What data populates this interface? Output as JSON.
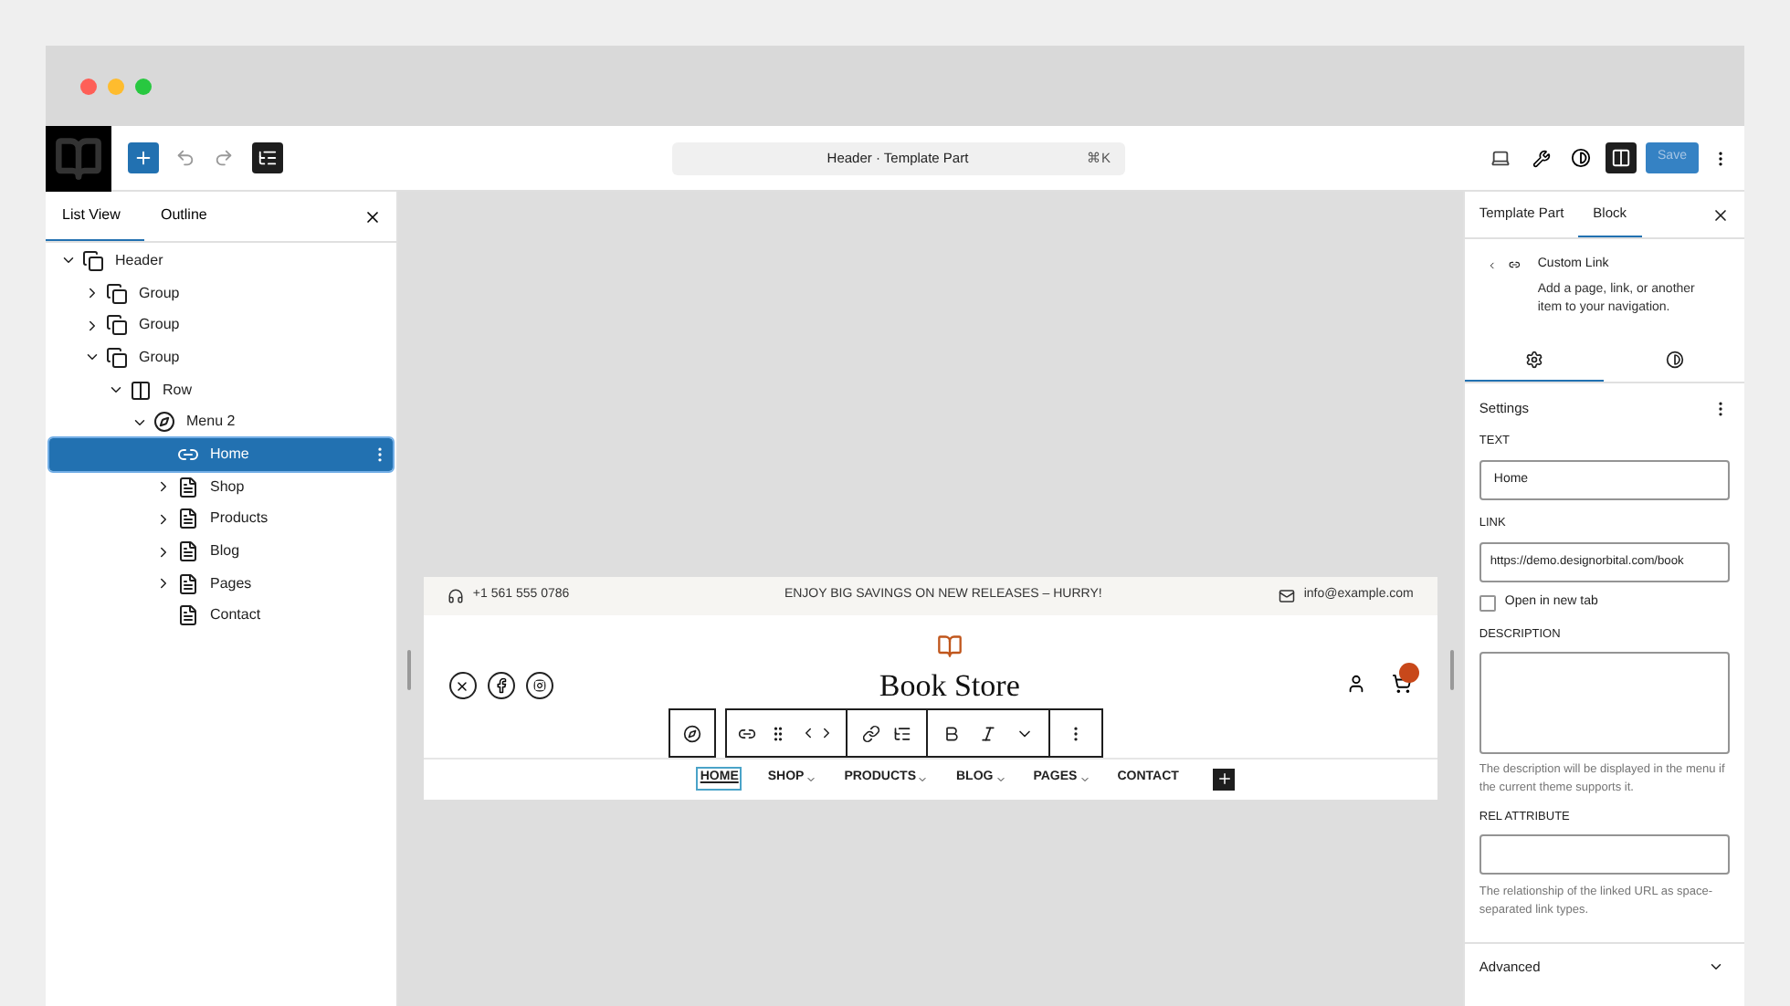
{
  "toolbar": {
    "command_title": "Header · Template Part",
    "shortcut": "⌘K",
    "save_label": "Save"
  },
  "left_panel": {
    "tabs": [
      {
        "label": "List View",
        "selected": true
      },
      {
        "label": "Outline",
        "selected": false
      }
    ],
    "tree": [
      {
        "label": "Header",
        "kind": "group",
        "expanded": true,
        "selected": false,
        "children": [
          {
            "label": "Group",
            "kind": "group",
            "expanded": false,
            "selected": false
          },
          {
            "label": "Group",
            "kind": "group",
            "expanded": false,
            "selected": false
          },
          {
            "label": "Group",
            "kind": "group",
            "expanded": true,
            "selected": false,
            "children": [
              {
                "label": "Row",
                "kind": "row",
                "expanded": true,
                "selected": false,
                "children": [
                  {
                    "label": "Menu 2",
                    "kind": "navigation",
                    "expanded": true,
                    "selected": false,
                    "children": [
                      {
                        "label": "Home",
                        "kind": "link",
                        "selected": true
                      },
                      {
                        "label": "Shop",
                        "kind": "page",
                        "expanded": false,
                        "selected": false
                      },
                      {
                        "label": "Products",
                        "kind": "page",
                        "expanded": false,
                        "selected": false
                      },
                      {
                        "label": "Blog",
                        "kind": "page",
                        "expanded": false,
                        "selected": false
                      },
                      {
                        "label": "Pages",
                        "kind": "page",
                        "expanded": false,
                        "selected": false
                      },
                      {
                        "label": "Contact",
                        "kind": "page",
                        "selected": false
                      }
                    ]
                  }
                ]
              }
            ]
          }
        ]
      }
    ]
  },
  "canvas": {
    "phone": "+1 561 555 0786",
    "promo": "ENJOY BIG SAVINGS ON NEW RELEASES – HURRY!",
    "email": "info@example.com",
    "site_title": "Book Store",
    "nav": [
      {
        "label": "HOME",
        "submenu": false,
        "selected": true
      },
      {
        "label": "SHOP",
        "submenu": true,
        "selected": false
      },
      {
        "label": "PRODUCTS",
        "submenu": true,
        "selected": false
      },
      {
        "label": "BLOG",
        "submenu": true,
        "selected": false
      },
      {
        "label": "PAGES",
        "submenu": true,
        "selected": false
      },
      {
        "label": "CONTACT",
        "submenu": false,
        "selected": false
      }
    ]
  },
  "right_panel": {
    "tabs": [
      {
        "label": "Template Part",
        "selected": false
      },
      {
        "label": "Block",
        "selected": true
      }
    ],
    "block": {
      "title": "Custom Link",
      "description": "Add a page, link, or another item to your navigation."
    },
    "subtabs": [
      {
        "kind": "settings",
        "selected": true
      },
      {
        "kind": "styles",
        "selected": false
      }
    ],
    "settings_title": "Settings",
    "text_label": "TEXT",
    "text_value": "Home",
    "link_label": "LINK",
    "link_value": "https://demo.designorbital.com/book",
    "new_tab": {
      "label": "Open in new tab",
      "checked": false
    },
    "description_label": "DESCRIPTION",
    "description_help": "The description will be displayed in the menu if the current theme supports it.",
    "rel_label": "REL ATTRIBUTE",
    "rel_help": "The relationship of the linked URL as space-separated link types.",
    "advanced": "Advanced"
  }
}
